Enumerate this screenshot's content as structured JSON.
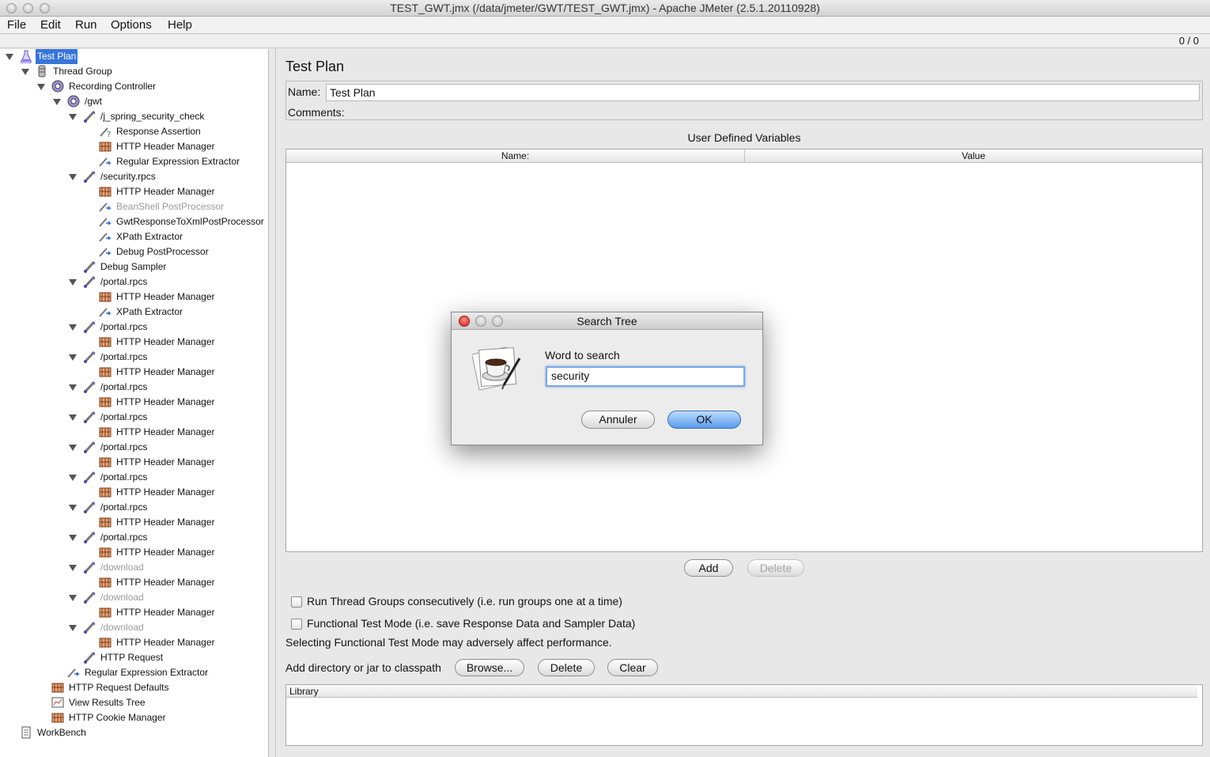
{
  "window": {
    "title": "TEST_GWT.jmx (/data/jmeter/GWT/TEST_GWT.jmx) - Apache JMeter (2.5.1.20110928)"
  },
  "menubar": {
    "items": [
      "File",
      "Edit",
      "Run",
      "Options",
      "Help"
    ]
  },
  "status": {
    "counter": "0 / 0"
  },
  "tree": {
    "nodes": [
      {
        "label": "Test Plan",
        "icon": "test-plan-icon",
        "selected": true
      },
      {
        "label": "Thread Group",
        "icon": "thread-group-icon"
      },
      {
        "label": "Recording Controller",
        "icon": "controller-icon"
      },
      {
        "label": "/gwt",
        "icon": "controller-icon"
      },
      {
        "label": "/j_spring_security_check",
        "icon": "sampler-icon"
      },
      {
        "label": "Response Assertion",
        "icon": "assertion-icon"
      },
      {
        "label": "HTTP Header Manager",
        "icon": "config-icon"
      },
      {
        "label": "Regular Expression Extractor",
        "icon": "postprocessor-icon"
      },
      {
        "label": "/security.rpcs",
        "icon": "sampler-icon"
      },
      {
        "label": "HTTP Header Manager",
        "icon": "config-icon"
      },
      {
        "label": "BeanShell PostProcessor",
        "icon": "postprocessor-icon",
        "disabled": true
      },
      {
        "label": "GwtResponseToXmlPostProcessor",
        "icon": "postprocessor-icon"
      },
      {
        "label": "XPath Extractor",
        "icon": "postprocessor-icon"
      },
      {
        "label": "Debug PostProcessor",
        "icon": "postprocessor-icon"
      },
      {
        "label": "Debug Sampler",
        "icon": "sampler-icon"
      },
      {
        "label": "/portal.rpcs",
        "icon": "sampler-icon"
      },
      {
        "label": "HTTP Header Manager",
        "icon": "config-icon"
      },
      {
        "label": "XPath Extractor",
        "icon": "postprocessor-icon"
      },
      {
        "label": "/portal.rpcs",
        "icon": "sampler-icon"
      },
      {
        "label": "HTTP Header Manager",
        "icon": "config-icon"
      },
      {
        "label": "/portal.rpcs",
        "icon": "sampler-icon"
      },
      {
        "label": "HTTP Header Manager",
        "icon": "config-icon"
      },
      {
        "label": "/portal.rpcs",
        "icon": "sampler-icon"
      },
      {
        "label": "HTTP Header Manager",
        "icon": "config-icon"
      },
      {
        "label": "/portal.rpcs",
        "icon": "sampler-icon"
      },
      {
        "label": "HTTP Header Manager",
        "icon": "config-icon"
      },
      {
        "label": "/portal.rpcs",
        "icon": "sampler-icon"
      },
      {
        "label": "HTTP Header Manager",
        "icon": "config-icon"
      },
      {
        "label": "/portal.rpcs",
        "icon": "sampler-icon"
      },
      {
        "label": "HTTP Header Manager",
        "icon": "config-icon"
      },
      {
        "label": "/portal.rpcs",
        "icon": "sampler-icon"
      },
      {
        "label": "HTTP Header Manager",
        "icon": "config-icon"
      },
      {
        "label": "/portal.rpcs",
        "icon": "sampler-icon"
      },
      {
        "label": "HTTP Header Manager",
        "icon": "config-icon"
      },
      {
        "label": "/download",
        "icon": "sampler-icon",
        "disabled": true
      },
      {
        "label": "HTTP Header Manager",
        "icon": "config-icon"
      },
      {
        "label": "/download",
        "icon": "sampler-icon",
        "disabled": true
      },
      {
        "label": "HTTP Header Manager",
        "icon": "config-icon"
      },
      {
        "label": "/download",
        "icon": "sampler-icon",
        "disabled": true
      },
      {
        "label": "HTTP Header Manager",
        "icon": "config-icon"
      },
      {
        "label": "HTTP Request",
        "icon": "sampler-icon"
      },
      {
        "label": "Regular Expression Extractor",
        "icon": "postprocessor-icon"
      },
      {
        "label": "HTTP Request Defaults",
        "icon": "config-icon"
      },
      {
        "label": "View Results Tree",
        "icon": "listener-icon"
      },
      {
        "label": "HTTP Cookie Manager",
        "icon": "config-icon"
      },
      {
        "label": "WorkBench",
        "icon": "workbench-icon"
      }
    ]
  },
  "main": {
    "title": "Test Plan",
    "name_label": "Name:",
    "name_value": "Test Plan",
    "comments_label": "Comments:",
    "udv_title": "User Defined Variables",
    "udv_columns": [
      "Name:",
      "Value"
    ],
    "add_label": "Add",
    "delete_label": "Delete",
    "run_consecutive_label": "Run Thread Groups consecutively (i.e. run groups one at a time)",
    "functional_mode_label": "Functional Test Mode (i.e. save Response Data and Sampler Data)",
    "functional_warning": "Selecting Functional Test Mode may adversely affect performance.",
    "classpath_label": "Add directory or jar to classpath",
    "browse_label": "Browse...",
    "cp_delete_label": "Delete",
    "clear_label": "Clear",
    "library_header": "Library"
  },
  "dialog": {
    "title": "Search Tree",
    "prompt": "Word to search",
    "search_value": "security",
    "cancel_label": "Annuler",
    "ok_label": "OK"
  },
  "colors": {
    "selection": "#3875d7",
    "ok_button": "#5b9bea"
  }
}
